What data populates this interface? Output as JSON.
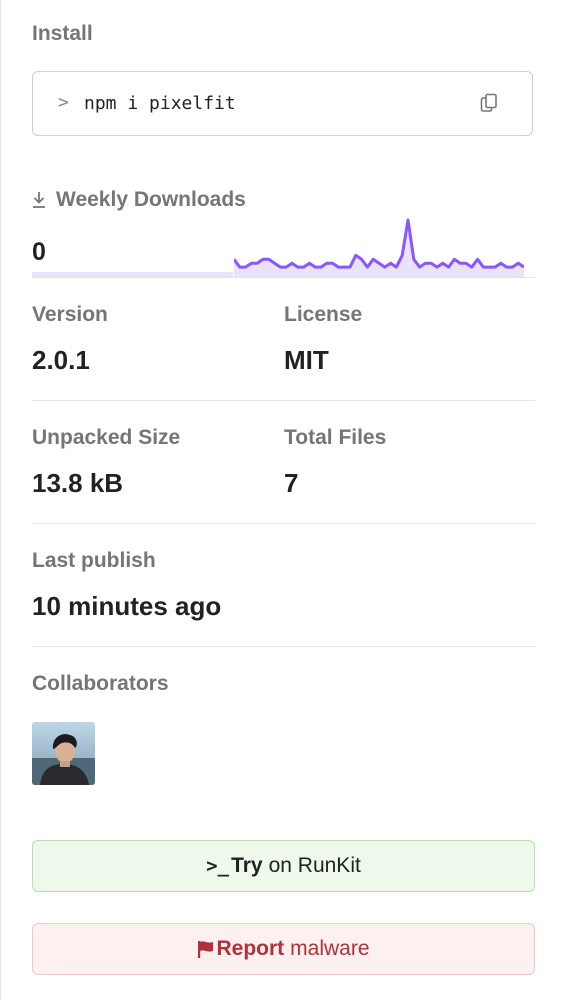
{
  "install": {
    "title": "Install",
    "prompt_symbol": ">",
    "command": "npm i pixelfit",
    "copy_icon": "copy-icon"
  },
  "downloads": {
    "title": "Weekly Downloads",
    "icon": "download-icon",
    "count": "0",
    "sparkline_color": "#8956ff",
    "sparkline_values": [
      4,
      2,
      2,
      3,
      3,
      4,
      4,
      3,
      2,
      2,
      3,
      2,
      2,
      3,
      2,
      2,
      3,
      3,
      2,
      2,
      2,
      5,
      4,
      2,
      4,
      3,
      2,
      3,
      2,
      5,
      14,
      4,
      2,
      3,
      3,
      2,
      3,
      2,
      4,
      3,
      3,
      2,
      4,
      2,
      2,
      2,
      3,
      2,
      2,
      3,
      2
    ]
  },
  "stats": {
    "version": {
      "label": "Version",
      "value": "2.0.1"
    },
    "license": {
      "label": "License",
      "value": "MIT"
    },
    "unpacked_size": {
      "label": "Unpacked Size",
      "value": "13.8 kB"
    },
    "total_files": {
      "label": "Total Files",
      "value": "7"
    },
    "last_publish": {
      "label": "Last publish",
      "value": "10 minutes ago"
    }
  },
  "collaborators": {
    "title": "Collaborators",
    "avatar_icon": "avatar"
  },
  "buttons": {
    "runkit": {
      "icon_text": ">_",
      "bold": "Try",
      "rest": "on RunKit",
      "color": "#eef9ec"
    },
    "report": {
      "bold": "Report",
      "rest": "malware",
      "color": "#b2303a"
    }
  }
}
